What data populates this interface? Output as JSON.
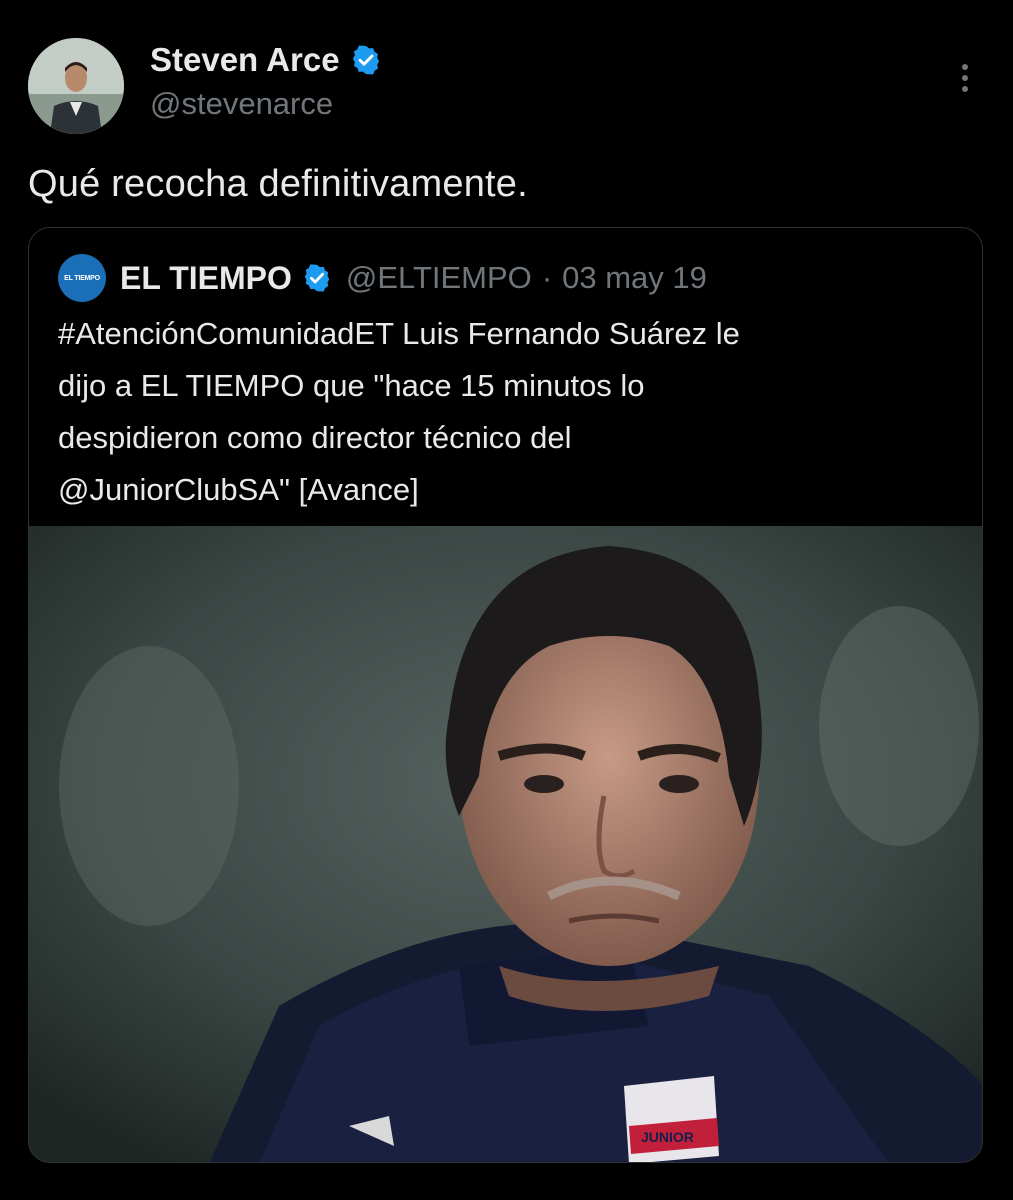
{
  "tweet": {
    "author": {
      "display_name": "Steven Arce",
      "handle": "@stevenarce",
      "verified": true
    },
    "text": "Qué recocha definitivamente.",
    "more_icon": "more-vertical-icon"
  },
  "quote": {
    "author": {
      "avatar_text": "EL TIEMPO",
      "display_name": "EL TIEMPO",
      "handle": "@ELTIEMPO",
      "separator": "·",
      "date": "03 may 19",
      "verified": true
    },
    "text_lines": [
      "#AtenciónComunidadET Luis Fernando Suárez le",
      "dijo a EL TIEMPO que \"hace 15 minutos lo",
      "despidieron como director técnico del",
      "@JuniorClubSA\" [Avance]"
    ],
    "media": {
      "badge_text": "JUNIOR"
    }
  },
  "colors": {
    "background": "#000000",
    "text": "#e7e9ea",
    "muted": "#71767b",
    "verified_blue": "#1d9bf0",
    "border": "#2f3336"
  }
}
